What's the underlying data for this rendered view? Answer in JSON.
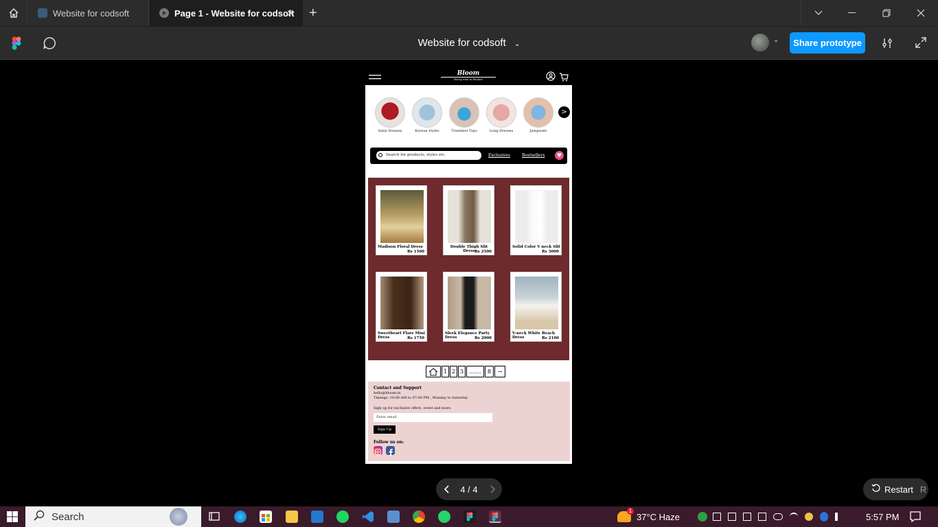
{
  "browser": {
    "tabs": [
      {
        "label": "Website for codsoft"
      },
      {
        "label": "Page 1 - Website for codsoft"
      }
    ],
    "new_tab": "+",
    "close": "✕"
  },
  "toolbar": {
    "title": "Website for codsoft",
    "share_label": "Share prototype"
  },
  "site": {
    "logo_name": "Bloom",
    "logo_tagline": "Every Size is Perfect",
    "categories": [
      {
        "label": "Satin Dresses"
      },
      {
        "label": "Korean Styles"
      },
      {
        "label": "Trendiest Tops"
      },
      {
        "label": "Long Dresses"
      },
      {
        "label": "Jumpsuits"
      }
    ],
    "next_arrow": ">",
    "search_placeholder": "Search for products, styles etc.",
    "nav_exclusives": "Exclusives",
    "nav_bestsellers": "Bestsellers",
    "products": [
      {
        "name": "Madison Floral Dress",
        "price": "Rs 1500"
      },
      {
        "name": "Double Thigh Slit Dress",
        "price": "Rs 2500"
      },
      {
        "name": "Solid Color V neck Slit",
        "price": "Rs 3000"
      },
      {
        "name": "Sweetheart Flare Mini Dress",
        "price": "Rs 1750"
      },
      {
        "name": "Sleek Elegance Party Dress",
        "price": "Rs 2000"
      },
      {
        "name": "V-neck White Beach Dress",
        "price": "Rs 2100"
      }
    ],
    "pagination": {
      "p1": "1",
      "p2": "2",
      "p3": "3",
      "dots": ".......",
      "p8": "8",
      "next": "→"
    },
    "footer": {
      "contact_title": "Contact and Support",
      "email": "hello@bloom.in",
      "timings": "Timings: 10:00 AM to 07:00 PM , Monday to Saturday",
      "signup_text": "Sign up for exclusive offers, event and more.",
      "email_placeholder": "Enter email",
      "signup_button": "Sign Up",
      "follow": "Follow us on:"
    }
  },
  "prototype_controls": {
    "page_indicator": "4 / 4",
    "restart_label": "Restart",
    "restart_shortcut": "R"
  },
  "taskbar": {
    "search_label": "Search",
    "weather": "37°C  Haze",
    "weather_badge": "1",
    "time": "5:57 PM"
  },
  "colors": {
    "accent": "#0d99ff",
    "product_panel": "#6e2a2d",
    "footer_bg": "#ecd3d2",
    "heart": "#e6547a"
  }
}
